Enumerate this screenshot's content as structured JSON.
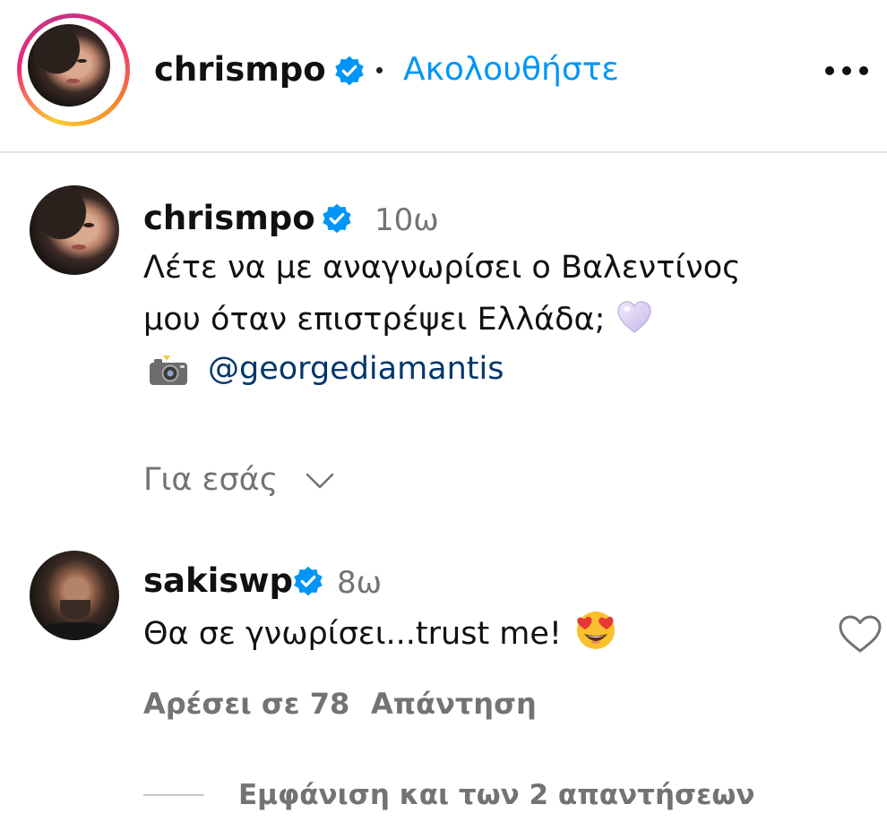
{
  "header": {
    "username": "chrismpo",
    "separator": "•",
    "follow_label": "Ακολουθήστε",
    "more_icon": "more-horizontal-icon",
    "verified_icon": "verified-badge-icon"
  },
  "caption": {
    "username": "chrismpo",
    "time": "10ω",
    "line_1": "Λέτε να με αναγνωρίσει ο Βαλεντίνος",
    "line_2": "μου όταν επιστρέψει Ελλάδα;",
    "heart_emoji": "light-purple-heart-emoji",
    "camera_emoji": "camera-with-flash-emoji",
    "mention": "@georgediamantis"
  },
  "for_you": {
    "label": "Για εσάς",
    "icon": "chevron-down-icon"
  },
  "reply": {
    "username": "sakiswp",
    "time": "8ω",
    "text": "Θα σε γνωρίσει...trust me!",
    "emoji": "smiling-face-with-heart-eyes-emoji",
    "likes_label": "Αρέσει σε 78",
    "reply_label": "Απάντηση",
    "like_icon": "heart-outline-icon"
  },
  "view_replies": {
    "label": "Εμφάνιση και των 2 απαντήσεων"
  },
  "colors": {
    "link_blue": "#0095f6",
    "mention_blue": "#00376b",
    "secondary_text": "#737373",
    "verified_blue": "#0095f6",
    "divider": "#e2e2e2"
  }
}
